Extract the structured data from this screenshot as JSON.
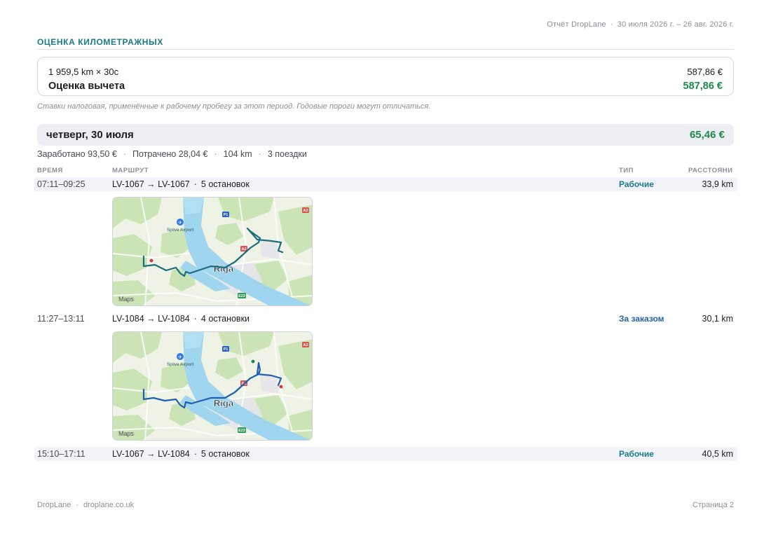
{
  "header": {
    "report": "Отчёт DropLane",
    "period": "30 июля 2026 г. – 26 авг. 2026 г."
  },
  "section": {
    "title": "ОЦЕНКА КИЛОМЕТРАЖНЫХ"
  },
  "summary": {
    "calc_label": "1 959,5 km × 30c",
    "calc_value": "587,86 €",
    "deduction_label": "Оценка вычета",
    "deduction_value": "587,86 €"
  },
  "note": "Ставки налоговая, применённые к рабочему пробегу за этот период. Годовые пороги могут отличаться.",
  "day": {
    "label": "четверг, 30 июля",
    "total": "65,46 €",
    "stats": {
      "earned": "Заработано 93,50 €",
      "spent": "Потрачено 28,04 €",
      "distance": "104 km",
      "trips": "3 поездки"
    }
  },
  "columns": {
    "time": "ВРЕМЯ",
    "route": "МАРШРУТ",
    "type": "ТИП",
    "distance": "РАССТОЯНИ"
  },
  "trips": [
    {
      "time": "07:11–09:25",
      "route": "LV-1067 → LV-1067",
      "stops": "5 остановок",
      "type": "Рабочие",
      "type_color": "#1a7a86",
      "distance": "33,9 km"
    },
    {
      "time": "11:27–13:11",
      "route": "LV-1084 → LV-1084",
      "stops": "4 остановки",
      "type": "За заказом",
      "type_color": "#2563a8",
      "distance": "30,1 km"
    },
    {
      "time": "15:10–17:11",
      "route": "LV-1067 → LV-1084",
      "stops": "5 остановок",
      "type": "Рабочие",
      "type_color": "#1a7a86",
      "distance": "40,5 km"
    }
  ],
  "map": {
    "airport_label": "Spilve Airport",
    "city_label": "Rīga",
    "attribution": "Maps",
    "road_badges": [
      "P1",
      "A2",
      "A2",
      "E22"
    ],
    "route_color_work": "#1a6d7d",
    "route_color_order": "#1f5fb0"
  },
  "footer": {
    "brand": "DropLane",
    "site": "droplane.co.uk",
    "page": "Страница 2"
  }
}
